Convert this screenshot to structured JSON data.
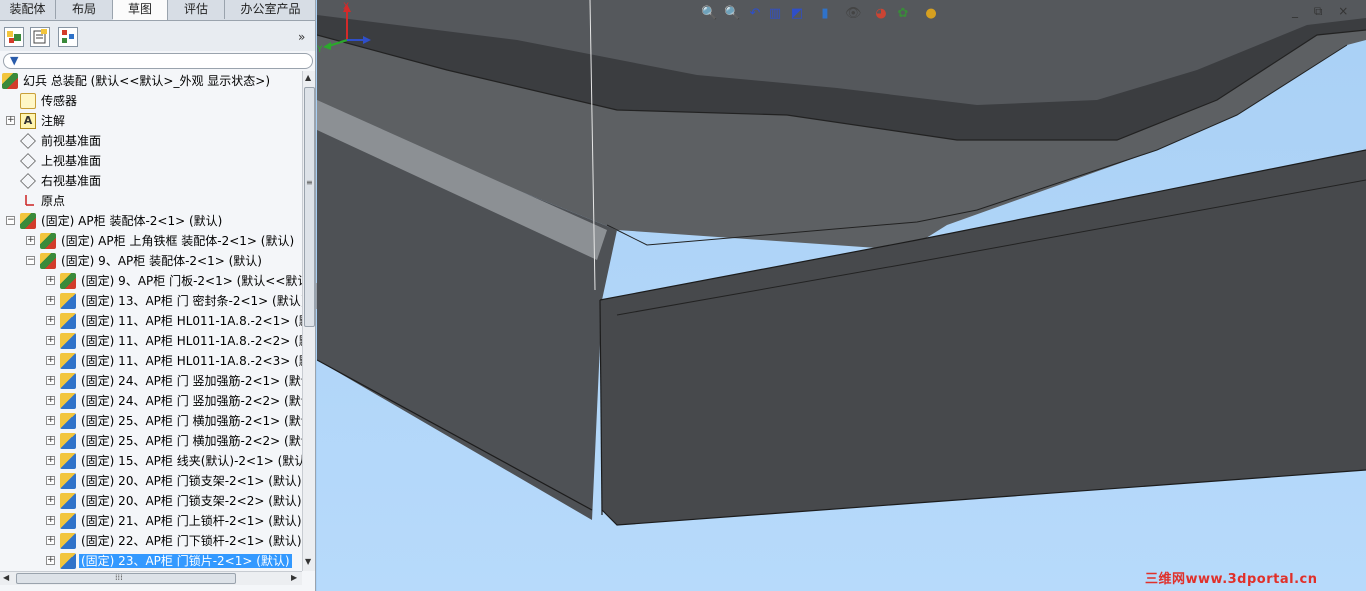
{
  "tabs": [
    {
      "label": "装配体"
    },
    {
      "label": "布局"
    },
    {
      "label": "草图",
      "active": true
    },
    {
      "label": "评估"
    },
    {
      "label": "办公室产品"
    }
  ],
  "feature_manager": {
    "toolbar_icons": [
      "feature-manager-icon",
      "property-manager-icon",
      "configuration-manager-icon"
    ],
    "expand_glyph": "»",
    "filter_glyph": "▼"
  },
  "tree": [
    {
      "label": "幻兵 总装配  (默认<<默认>_外观 显示状态>)",
      "icon": "assembly-icon"
    },
    {
      "label": "传感器",
      "icon": "sensor-icon"
    },
    {
      "label": "注解",
      "icon": "annotation-icon"
    },
    {
      "label": "前视基准面",
      "icon": "plane-icon"
    },
    {
      "label": "上视基准面",
      "icon": "plane-icon"
    },
    {
      "label": "右视基准面",
      "icon": "plane-icon"
    },
    {
      "label": "原点",
      "icon": "origin-icon"
    },
    {
      "label": "(固定) AP柜 装配体-2<1> (默认)",
      "icon": "assembly-icon"
    },
    {
      "label": "(固定) AP柜 上角铁框 装配体-2<1> (默认)",
      "icon": "assembly-icon"
    },
    {
      "label": "(固定) 9、AP柜 装配体-2<1> (默认)",
      "icon": "assembly-icon"
    },
    {
      "label": "(固定) 9、AP柜 门板-2<1> (默认<<默认",
      "icon": "assembly-icon"
    },
    {
      "label": "(固定) 13、AP柜 门 密封条-2<1> (默认)",
      "icon": "part-icon"
    },
    {
      "label": "(固定) 11、AP柜  HL011-1A.8.-2<1> (默",
      "icon": "part-icon"
    },
    {
      "label": "(固定) 11、AP柜  HL011-1A.8.-2<2> (默",
      "icon": "part-icon"
    },
    {
      "label": "(固定) 11、AP柜  HL011-1A.8.-2<3> (默",
      "icon": "part-icon"
    },
    {
      "label": "(固定) 24、AP柜 门 竖加强筋-2<1> (默认",
      "icon": "part-icon"
    },
    {
      "label": "(固定) 24、AP柜 门 竖加强筋-2<2> (默认",
      "icon": "part-icon"
    },
    {
      "label": "(固定) 25、AP柜 门 横加强筋-2<1> (默认",
      "icon": "part-icon"
    },
    {
      "label": "(固定) 25、AP柜 门 横加强筋-2<2> (默认",
      "icon": "part-icon"
    },
    {
      "label": "(固定) 15、AP柜 线夹(默认)-2<1> (默认)",
      "icon": "part-icon"
    },
    {
      "label": "(固定) 20、AP柜 门锁支架-2<1> (默认)",
      "icon": "part-icon"
    },
    {
      "label": "(固定) 20、AP柜 门锁支架-2<2> (默认)",
      "icon": "part-icon"
    },
    {
      "label": "(固定) 21、AP柜 门上锁杆-2<1> (默认)",
      "icon": "part-icon"
    },
    {
      "label": "(固定) 22、AP柜 门下锁杆-2<1> (默认)",
      "icon": "part-icon"
    },
    {
      "label": "(固定) 23、AP柜 门锁片-2<1> (默认)",
      "icon": "part-icon",
      "selected": true
    }
  ],
  "scroll": {
    "up": "▲",
    "down": "▼",
    "left": "◀",
    "right": "▶",
    "grip": "≡",
    "hgrip": "⁞⁞⁞"
  },
  "collapse_glyph": "◀",
  "heads_up_toolbar": [
    {
      "icon": "zoom-to-fit-icon",
      "glyph": "🔍"
    },
    {
      "icon": "zoom-to-area-icon",
      "glyph": "🔍"
    },
    {
      "icon": "previous-view-icon",
      "glyph": "↶"
    },
    {
      "icon": "section-view-icon",
      "glyph": "▥"
    },
    {
      "icon": "view-orientation-icon",
      "glyph": "◩"
    },
    {
      "icon": "display-style-icon",
      "glyph": "▮"
    },
    {
      "icon": "hide-show-items-icon",
      "glyph": "👁"
    },
    {
      "icon": "edit-appearance-icon",
      "glyph": "◕"
    },
    {
      "icon": "apply-scene-icon",
      "glyph": "✿"
    },
    {
      "icon": "realview-icon",
      "glyph": "●"
    }
  ],
  "window_controls": "_ ⧉ ×",
  "task_pane": [
    {
      "icon": "resources-home-icon",
      "glyph": "⌂"
    },
    {
      "icon": "design-library-icon",
      "glyph": "▦"
    },
    {
      "icon": "file-explorer-icon",
      "glyph": "▭"
    },
    {
      "icon": "search-icon",
      "glyph": "◉"
    },
    {
      "icon": "view-palette-icon",
      "glyph": "☷"
    },
    {
      "icon": "appearances-icon",
      "glyph": "◑"
    },
    {
      "icon": "custom-properties-icon",
      "glyph": "✎"
    }
  ],
  "triad": {
    "x_label": "X",
    "y_label": "Y"
  },
  "watermark": "三维网www.3dportal.cn"
}
